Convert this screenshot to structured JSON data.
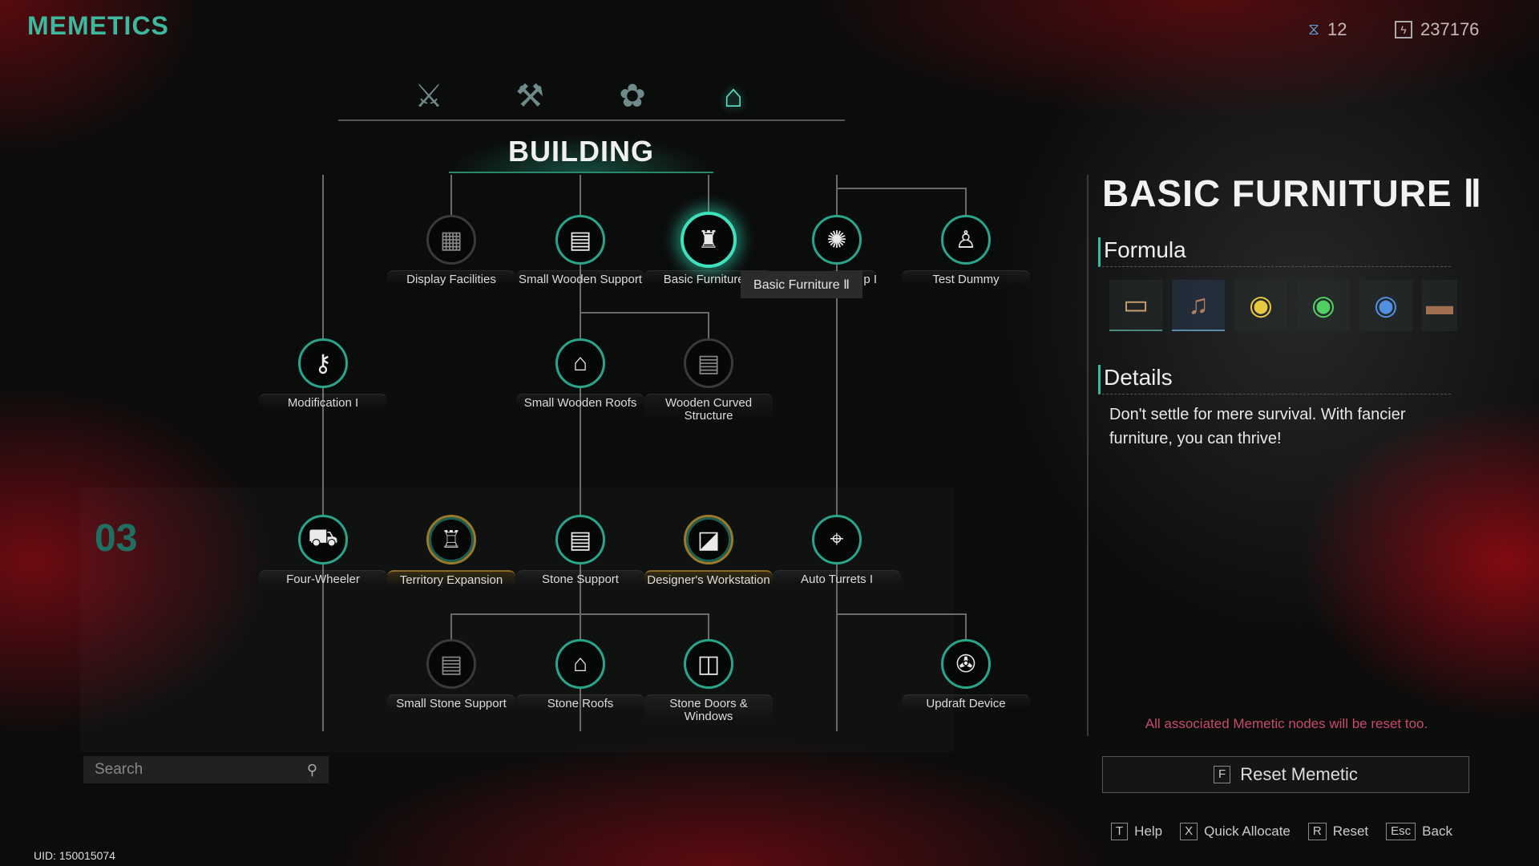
{
  "header": {
    "title": "MEMETICS",
    "stats": [
      {
        "icon": "dna-icon",
        "value": "12"
      },
      {
        "icon": "energy-icon",
        "value": "237176"
      }
    ]
  },
  "tabs": [
    {
      "icon": "weapon-icon"
    },
    {
      "icon": "workbench-icon"
    },
    {
      "icon": "plant-icon"
    },
    {
      "icon": "house-icon",
      "active": true
    }
  ],
  "tree": {
    "category": "BUILDING",
    "section_number": "03",
    "tooltip": "Basic Furniture Ⅱ",
    "nodes": [
      {
        "label": "Display Facilities",
        "state": "locked",
        "icon": "crate-icon"
      },
      {
        "label": "Small Wooden Support",
        "state": "unlocked",
        "icon": "cabinet-icon"
      },
      {
        "label": "Basic Furniture Ⅱ",
        "state": "selected",
        "icon": "lamp-icon"
      },
      {
        "label": "p I",
        "state": "unlocked",
        "icon": "trap-icon"
      },
      {
        "label": "Test Dummy",
        "state": "unlocked",
        "icon": "dummy-icon"
      },
      {
        "label": "Modification I",
        "state": "unlocked",
        "icon": "wrench-icon"
      },
      {
        "label": "Small Wooden Roofs",
        "state": "unlocked",
        "icon": "roof-icon"
      },
      {
        "label": "Wooden Curved Structure",
        "state": "locked",
        "icon": "cabinet-icon"
      },
      {
        "label": "Four-Wheeler",
        "state": "unlocked",
        "icon": "car-icon"
      },
      {
        "label": "Territory Expansion",
        "state": "gold",
        "icon": "tower-icon"
      },
      {
        "label": "Stone Support",
        "state": "unlocked",
        "icon": "cabinet-icon"
      },
      {
        "label": "Designer's Workstation",
        "state": "gold",
        "icon": "easel-icon"
      },
      {
        "label": "Auto Turrets I",
        "state": "unlocked",
        "icon": "turret-icon"
      },
      {
        "label": "Small Stone Support",
        "state": "locked",
        "icon": "cabinet-icon"
      },
      {
        "label": "Stone Roofs",
        "state": "unlocked",
        "icon": "roof-icon"
      },
      {
        "label": "Stone Doors & Windows",
        "state": "unlocked",
        "icon": "door-icon"
      },
      {
        "label": "Updraft Device",
        "state": "unlocked",
        "icon": "fan-icon"
      }
    ]
  },
  "search": {
    "placeholder": "Search",
    "value": ""
  },
  "uid": "UID: 150015074",
  "panel": {
    "title": "BASIC FURNITURE Ⅱ",
    "formula_heading": "Formula",
    "formula_items": [
      {
        "icon": "tv-cabinet-icon"
      },
      {
        "icon": "piano-icon"
      },
      {
        "icon": "yellow-lamp-icon"
      },
      {
        "icon": "green-lamp-icon"
      },
      {
        "icon": "blue-lamp-icon"
      },
      {
        "icon": "rug-icon"
      }
    ],
    "details_heading": "Details",
    "details": "Don't settle for mere survival. With fancier furniture, you can thrive!",
    "warning": "All associated Memetic nodes will be reset too.",
    "reset_key": "F",
    "reset_label": "Reset Memetic"
  },
  "hints": [
    {
      "key": "T",
      "label": "Help"
    },
    {
      "key": "X",
      "label": "Quick Allocate"
    },
    {
      "key": "R",
      "label": "Reset"
    },
    {
      "key": "Esc",
      "label": "Back"
    }
  ],
  "colors": {
    "accent": "#2fbf9f",
    "gold": "#9a7a2a",
    "warning": "#c94a6a"
  }
}
